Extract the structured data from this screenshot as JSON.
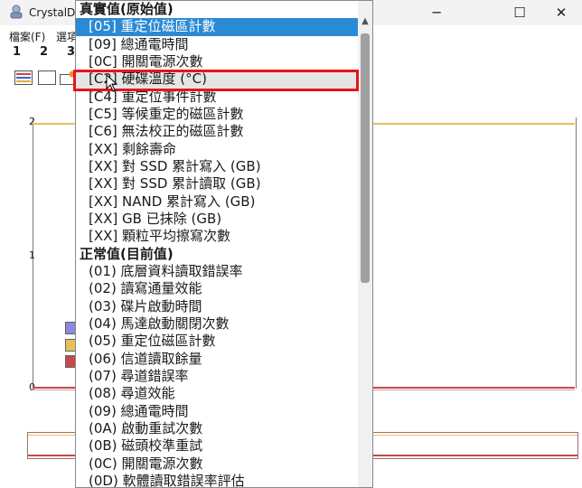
{
  "window": {
    "title": "CrystalDi",
    "minimize_label": "─",
    "maximize_label": "☐",
    "close_label": "✕"
  },
  "menu": {
    "file": "檔案(F)",
    "options": "選項"
  },
  "disks": [
    "1",
    "2",
    "3"
  ],
  "graph": {
    "y_ticks": [
      "2",
      "1",
      "0"
    ]
  },
  "dropdown": {
    "items": [
      {
        "label": "真實值(原始值)",
        "kind": "group"
      },
      {
        "label": "[05] 重定位磁區計數",
        "kind": "selected"
      },
      {
        "label": "[09] 總通電時間",
        "kind": "item"
      },
      {
        "label": "[0C] 開關電源次數",
        "kind": "item"
      },
      {
        "label": "[C2] 硬碟溫度 (°C)",
        "kind": "hover"
      },
      {
        "label": "[C4] 重定位事件計數",
        "kind": "item"
      },
      {
        "label": "[C5] 等候重定的磁區計數",
        "kind": "item"
      },
      {
        "label": "[C6] 無法校正的磁區計數",
        "kind": "item"
      },
      {
        "label": "[XX] 剩餘壽命",
        "kind": "item"
      },
      {
        "label": "[XX] 對 SSD 累計寫入 (GB)",
        "kind": "item"
      },
      {
        "label": "[XX] 對 SSD 累計讀取 (GB)",
        "kind": "item"
      },
      {
        "label": "[XX] NAND 累計寫入 (GB)",
        "kind": "item"
      },
      {
        "label": "[XX] GB 已抹除 (GB)",
        "kind": "item"
      },
      {
        "label": "[XX] 顆粒平均擦寫次數",
        "kind": "item"
      },
      {
        "label": "正常值(目前值)",
        "kind": "group"
      },
      {
        "label": "(01) 底層資料讀取錯誤率",
        "kind": "item"
      },
      {
        "label": "(02) 讀寫通量效能",
        "kind": "item"
      },
      {
        "label": "(03) 碟片啟動時間",
        "kind": "item"
      },
      {
        "label": "(04) 馬達啟動關閉次數",
        "kind": "item"
      },
      {
        "label": "(05) 重定位磁區計數",
        "kind": "item"
      },
      {
        "label": "(06) 信道讀取餘量",
        "kind": "item"
      },
      {
        "label": "(07) 尋道錯誤率",
        "kind": "item"
      },
      {
        "label": "(08) 尋道效能",
        "kind": "item"
      },
      {
        "label": "(09) 總通電時間",
        "kind": "item"
      },
      {
        "label": "(0A) 啟動重試次數",
        "kind": "item"
      },
      {
        "label": "(0B) 磁頭校準重試",
        "kind": "item"
      },
      {
        "label": "(0C) 開關電源次數",
        "kind": "item"
      },
      {
        "label": "(0D) 軟體讀取錯誤率評估",
        "kind": "item"
      }
    ]
  },
  "colors": {
    "selected": "#2a8ad4",
    "highlight_frame": "#e8141e",
    "series_yellow": "#e8c05a",
    "series_red": "#c84848",
    "series_blue": "#8a8ae0"
  }
}
